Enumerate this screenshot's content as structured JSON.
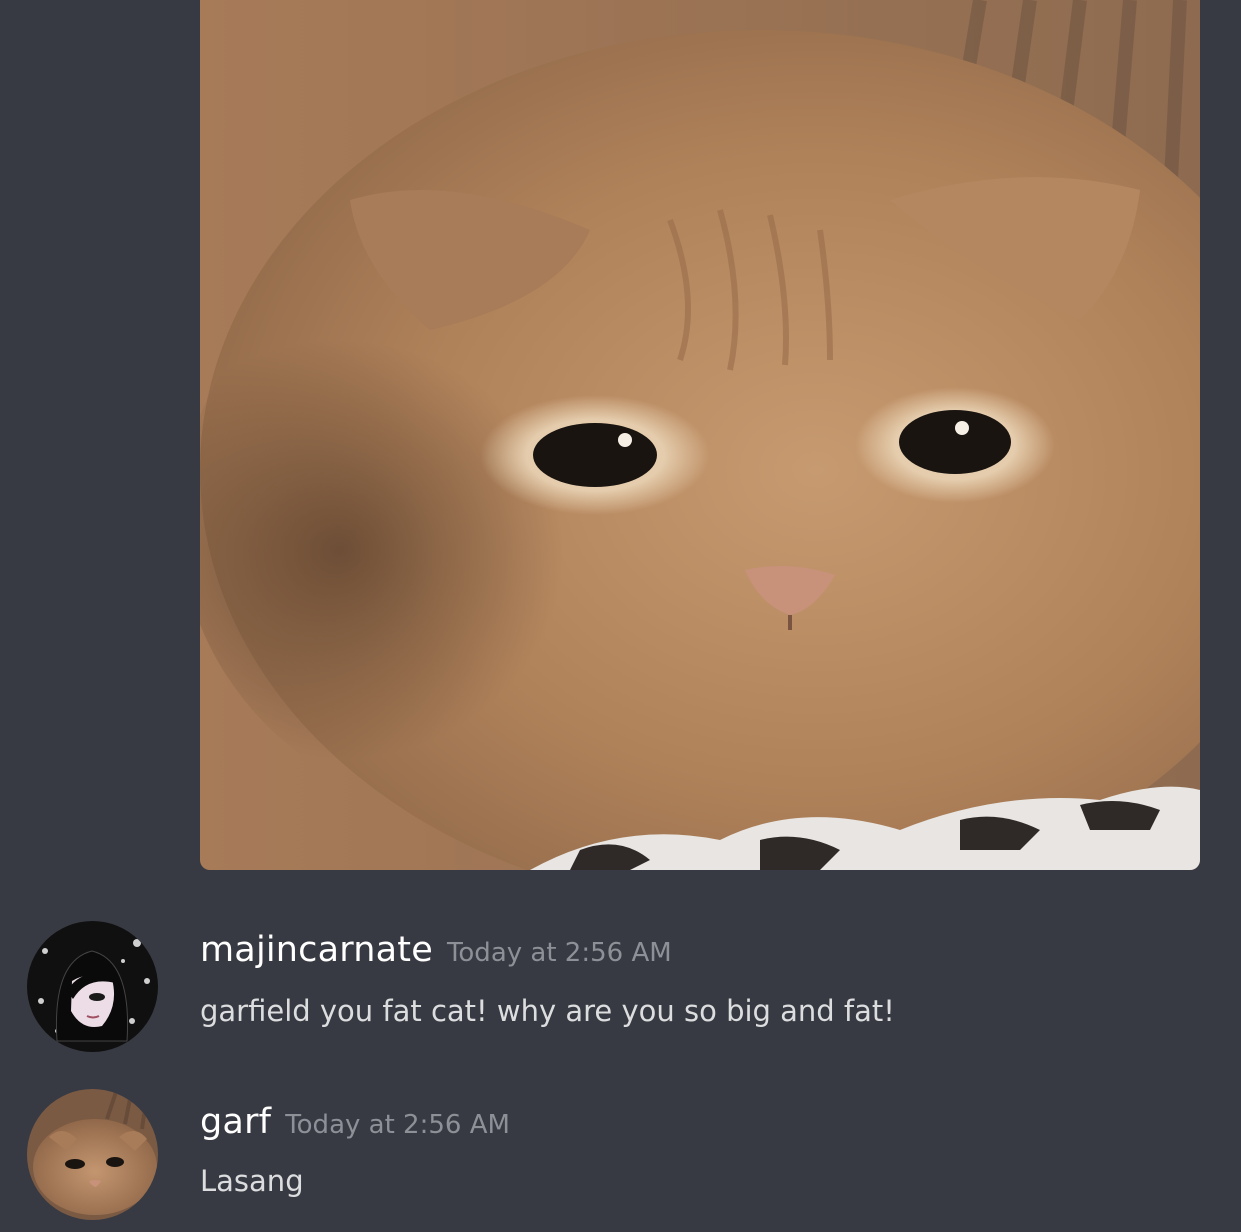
{
  "colors": {
    "background": "#383a43",
    "username": "#ffffff",
    "timestamp": "#8e9097",
    "message_text": "#dcddde"
  },
  "attachment": {
    "type": "image",
    "icon": "cat-photo"
  },
  "messages": [
    {
      "username": "majincarnate",
      "timestamp": "Today at 2:56 AM",
      "content": "garfield you fat cat! why are you so big and fat!",
      "avatar": "anime-character-avatar"
    },
    {
      "username": "garf",
      "timestamp": "Today at 2:56 AM",
      "content": "Lasang",
      "avatar": "cat-avatar"
    }
  ]
}
